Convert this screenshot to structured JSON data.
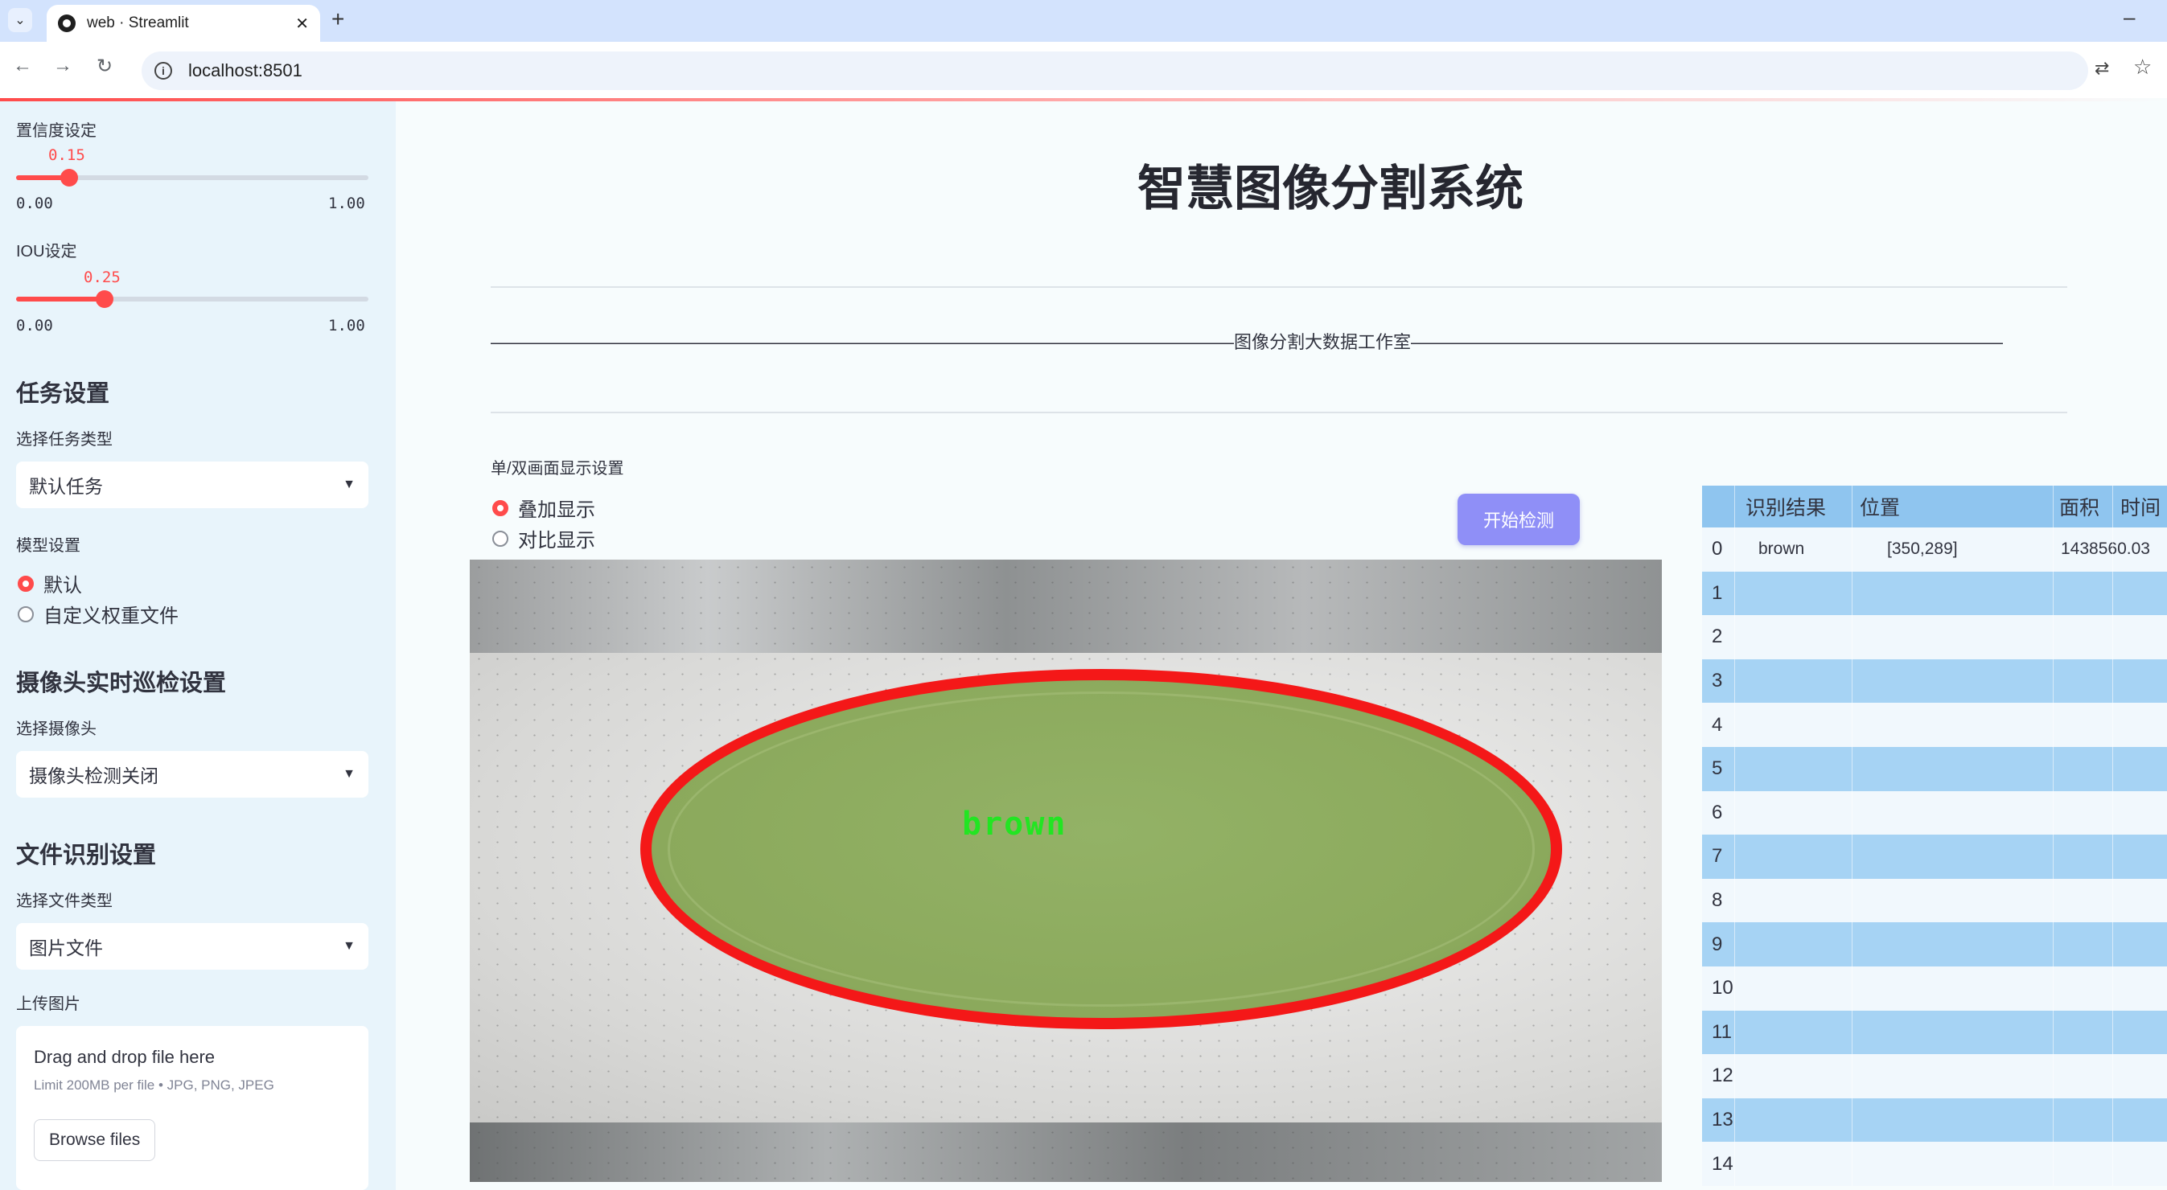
{
  "browser": {
    "tab_title": "web · Streamlit",
    "url": "localhost:8501"
  },
  "sidebar": {
    "confidence": {
      "label": "置信度设定",
      "value": "0.15",
      "fraction": 0.15,
      "min": "0.00",
      "max": "1.00"
    },
    "iou": {
      "label": "IOU设定",
      "value": "0.25",
      "fraction": 0.25,
      "min": "0.00",
      "max": "1.00"
    },
    "task_heading": "任务设置",
    "task_type_label": "选择任务类型",
    "task_type_value": "默认任务",
    "model_label": "模型设置",
    "model_options": [
      "默认",
      "自定义权重文件"
    ],
    "model_selected": 0,
    "camera_heading": "摄像头实时巡检设置",
    "camera_label": "选择摄像头",
    "camera_value": "摄像头检测关闭",
    "file_heading": "文件识别设置",
    "file_type_label": "选择文件类型",
    "file_type_value": "图片文件",
    "upload_label": "上传图片",
    "upload_title": "Drag and drop file here",
    "upload_limit": "Limit 200MB per file • JPG, PNG, JPEG",
    "upload_button": "Browse files"
  },
  "main": {
    "title": "智慧图像分割系统",
    "studio_line": "——————————————————————————————————————————图像分割大数据工作室——————————————————————————————————————————",
    "display_label": "单/双画面显示设置",
    "display_options": [
      "叠加显示",
      "对比显示"
    ],
    "display_selected": 0,
    "detect_button": "开始检测",
    "detection_label": "brown"
  },
  "results_table": {
    "columns": [
      "",
      "识别结果",
      "位置",
      "面积",
      "时间"
    ],
    "rows": [
      {
        "index": "0",
        "result": "brown",
        "position": "[350,289]",
        "area": "1438560.03",
        "time": ""
      },
      {
        "index": "1"
      },
      {
        "index": "2"
      },
      {
        "index": "3"
      },
      {
        "index": "4"
      },
      {
        "index": "5"
      },
      {
        "index": "6"
      },
      {
        "index": "7"
      },
      {
        "index": "8"
      },
      {
        "index": "9"
      },
      {
        "index": "10"
      },
      {
        "index": "11"
      },
      {
        "index": "12"
      },
      {
        "index": "13"
      },
      {
        "index": "14"
      }
    ]
  },
  "colors": {
    "accent": "#ff4b4b",
    "button": "#8f8ff7",
    "table_header": "#8fc5ef",
    "table_alt": "#a6d3f4",
    "contour": "#f41818",
    "label_text": "#22e522"
  }
}
